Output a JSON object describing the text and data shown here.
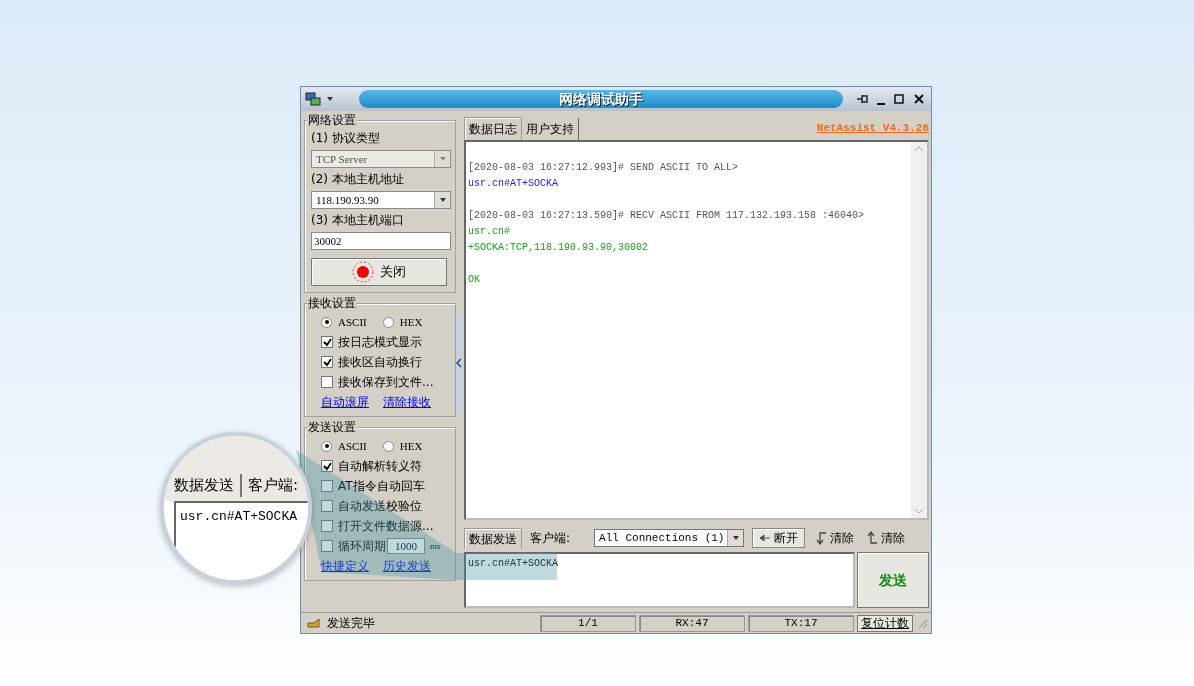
{
  "window": {
    "title": "网络调试助手"
  },
  "network_settings": {
    "title": "网络设置",
    "protocol_label": "(1) 协议类型",
    "protocol": "TCP Server",
    "host_label": "(2) 本地主机地址",
    "host": "118.190.93.90",
    "port_label": "(3) 本地主机端口",
    "port": "30002",
    "close_button": "关闭"
  },
  "receive_settings": {
    "title": "接收设置",
    "modes": [
      {
        "label": "ASCII",
        "selected": true
      },
      {
        "label": "HEX",
        "selected": false
      }
    ],
    "options": [
      {
        "label": "按日志模式显示",
        "checked": true
      },
      {
        "label": "接收区自动换行",
        "checked": true
      },
      {
        "label": "接收保存到文件...",
        "checked": false
      }
    ],
    "links": [
      "自动滚屏",
      "清除接收"
    ]
  },
  "send_settings": {
    "title": "发送设置",
    "modes": [
      {
        "label": "ASCII",
        "selected": true
      },
      {
        "label": "HEX",
        "selected": false
      }
    ],
    "options": [
      {
        "label": "自动解析转义符",
        "checked": true
      },
      {
        "label": "AT指令自动回车",
        "checked": false
      },
      {
        "label": "自动发送校验位",
        "checked": false
      },
      {
        "label": "打开文件数据源...",
        "checked": false
      }
    ],
    "cycle": {
      "label": "循环周期",
      "checked": false,
      "value": "1000",
      "unit": "ms"
    },
    "links": [
      "快捷定义",
      "历史发送"
    ]
  },
  "tabs": [
    {
      "label": "数据日志",
      "selected": true
    },
    {
      "label": "用户支持",
      "selected": false
    }
  ],
  "version": "NetAssist V4.3.26",
  "log": [
    {
      "kind": "header",
      "text": "[2020-08-03 16:27:12.993]# SEND ASCII TO ALL>"
    },
    {
      "kind": "sent",
      "text": "usr.cn#AT+SOCKA"
    },
    {
      "kind": "header",
      "text": "[2020-08-03 16:27:13.590]# RECV ASCII FROM 117.132.193.158 :46040>"
    },
    {
      "kind": "received",
      "text": "usr.cn#"
    },
    {
      "kind": "received",
      "text": "+SOCKA:TCP,118.190.93.90,30002"
    },
    {
      "kind": "gap"
    },
    {
      "kind": "received",
      "text": "OK"
    }
  ],
  "send": {
    "tab": "数据发送",
    "client_label": "客户端:",
    "client": "All Connections (1)",
    "disconnect_button": "断开",
    "clear_buttons": [
      "清除",
      "清除"
    ],
    "value": "usr.cn#AT+SOCKA",
    "send_button": "发送"
  },
  "status_bar": {
    "message": "发送完毕",
    "cells": [
      "1/1",
      "RX:47",
      "TX:17"
    ],
    "reset_button": "复位计数"
  },
  "magnifier": {
    "tab": "数据发送",
    "client_label": "客户端:",
    "text": "usr.cn#AT+SOCKA"
  }
}
